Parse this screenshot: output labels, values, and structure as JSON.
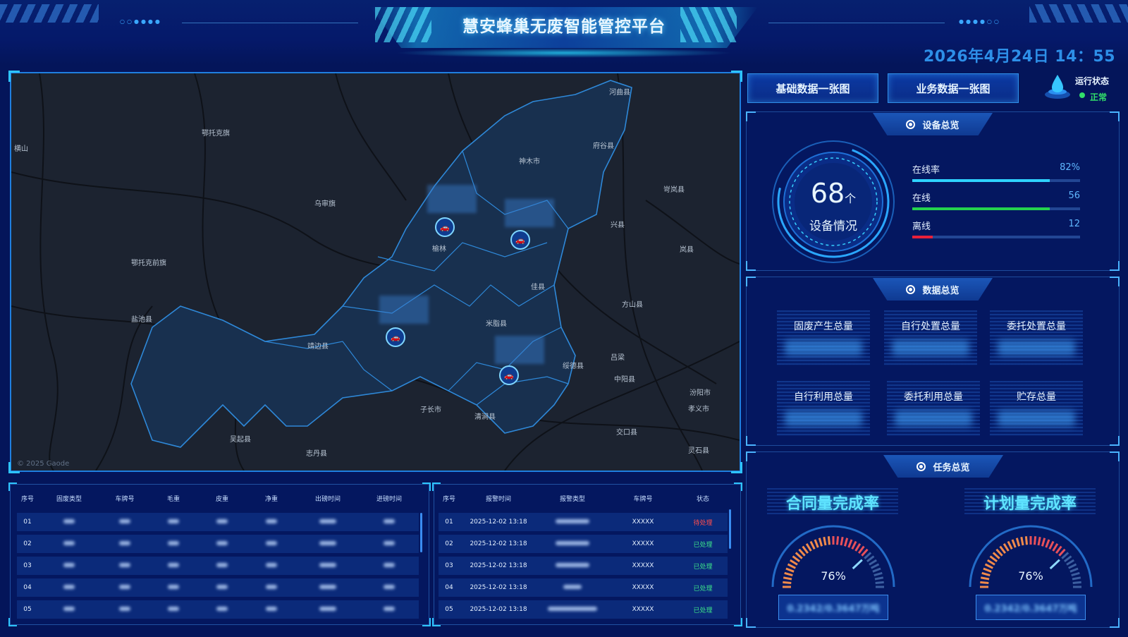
{
  "header": {
    "title": "慧安蜂巢无废智能管控平台",
    "datetime": "2026年4月24日 14：55"
  },
  "nav": {
    "btn_basic": "基础数据一张图",
    "btn_business": "业务数据一张图",
    "status_label": "运行状态",
    "status_value": "正常"
  },
  "map": {
    "labels": [
      "鄂托克旗",
      "乌审旗",
      "鄂托克前旗",
      "盐池县",
      "靖边县",
      "横山",
      "子长市",
      "吴起县",
      "志丹县",
      "神木市",
      "府谷县",
      "榆林",
      "佳县",
      "米脂县",
      "绥德县",
      "清涧县",
      "兴县",
      "岢岚县",
      "岚县",
      "方山县",
      "吕梁",
      "中阳县",
      "汾阳市",
      "孝义市",
      "交口县",
      "灵石县",
      "河曲县"
    ],
    "attribution": "© 2025 Gaode"
  },
  "device": {
    "tab": "设备总览",
    "count": "68",
    "unit": "个",
    "caption": "设备情况",
    "rows": [
      {
        "label": "在线率",
        "value": "82%",
        "pct": 82,
        "color": "#2fd3ff"
      },
      {
        "label": "在线",
        "value": "56",
        "pct": 82,
        "color": "#24d24e"
      },
      {
        "label": "离线",
        "value": "12",
        "pct": 12,
        "color": "#e8203a"
      }
    ]
  },
  "data_overview": {
    "tab": "数据总览",
    "boxes": [
      "固废产生总量",
      "自行处置总量",
      "委托处置总量",
      "自行利用总量",
      "委托利用总量",
      "贮存总量"
    ]
  },
  "task": {
    "tab": "任务总览",
    "contract_title": "合同量完成率",
    "contract_value": "76%",
    "contract_pct": 76,
    "contract_sub": "0.2342/0.3647万吨",
    "plan_title": "计划量完成率",
    "plan_value": "76%",
    "plan_pct": 76,
    "plan_sub": "0.2342/0.3647万吨"
  },
  "table_left": {
    "headers": [
      "序号",
      "固废类型",
      "车牌号",
      "毛重",
      "皮重",
      "净重",
      "出磅时间",
      "进磅时间"
    ],
    "rows": [
      "01",
      "02",
      "03",
      "04",
      "05"
    ]
  },
  "table_right": {
    "headers": [
      "序号",
      "报警时间",
      "报警类型",
      "车牌号",
      "状态"
    ],
    "rows": [
      {
        "no": "01",
        "time": "2025-12-02 13:18",
        "plate": "XXXXX",
        "status": "待处理",
        "red": true
      },
      {
        "no": "02",
        "time": "2025-12-02 13:18",
        "plate": "XXXXX",
        "status": "已处理",
        "red": false
      },
      {
        "no": "03",
        "time": "2025-12-02 13:18",
        "plate": "XXXXX",
        "status": "已处理",
        "red": false
      },
      {
        "no": "04",
        "time": "2025-12-02 13:18",
        "plate": "XXXXX",
        "status": "已处理",
        "red": false
      },
      {
        "no": "05",
        "time": "2025-12-02 13:18",
        "plate": "XXXXX",
        "status": "已处理",
        "red": false
      }
    ]
  }
}
